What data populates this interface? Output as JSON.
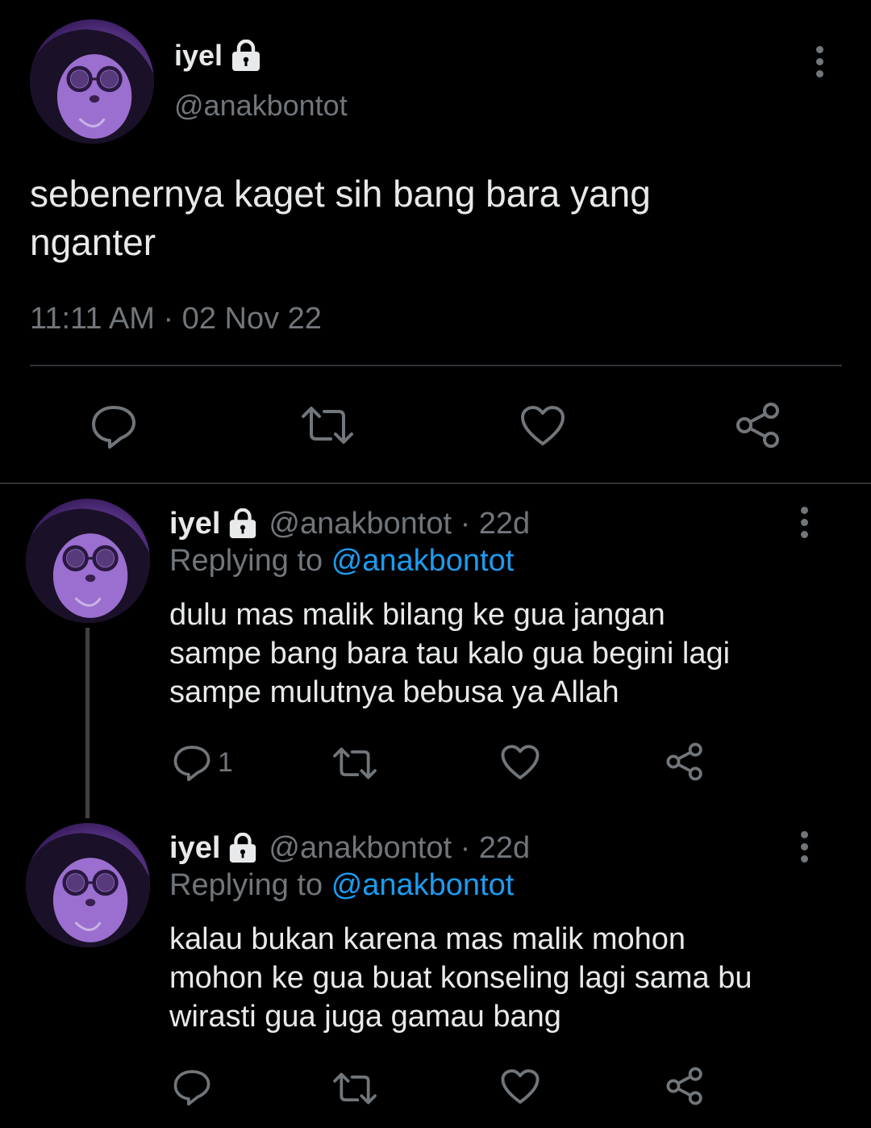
{
  "main_tweet": {
    "display_name": "iyel",
    "handle": "@anakbontot",
    "text_line1": "sebenernya kaget sih bang bara yang",
    "text_line2": "nganter",
    "timestamp": "11:11 AM · 02 Nov 22"
  },
  "replies": [
    {
      "display_name": "iyel",
      "handle_time": "@anakbontot · 22d",
      "replying_prefix": "Replying to",
      "replying_handle": "@anakbontot",
      "text_lines": [
        "dulu mas malik bilang ke gua jangan",
        "sampe bang bara tau kalo gua begini lagi",
        "sampe mulutnya bebusa ya Allah"
      ],
      "reply_count": "1"
    },
    {
      "display_name": "iyel",
      "handle_time": "@anakbontot · 22d",
      "replying_prefix": "Replying to",
      "replying_handle": "@anakbontot",
      "text_lines": [
        "kalau bukan karena mas malik mohon",
        "mohon ke gua buat konseling lagi sama bu",
        "wirasti gua juga gamau bang"
      ],
      "reply_count": ""
    }
  ],
  "icons": {
    "reply": "reply-icon",
    "retweet": "retweet-icon",
    "like": "heart-icon",
    "share": "share-icon",
    "more": "more-options-icon",
    "lock": "lock-icon"
  },
  "colors": {
    "background": "#000000",
    "text": "#e7e9ea",
    "muted": "#71767b",
    "link": "#1d9bf0",
    "divider": "#2f3336"
  }
}
